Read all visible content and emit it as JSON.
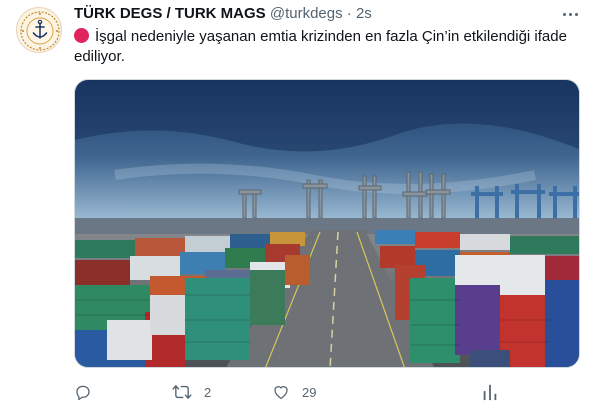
{
  "account": {
    "display_name": "TÜRK DEGS / TURK MAGS",
    "handle": "@turkdegs",
    "separator": "·",
    "time": "2s"
  },
  "tweet": {
    "text": "İşgal nedeniyle yaşanan emtia krizinden en fazla Çin’in etkilendiği ifade ediliyor.",
    "leading_emoji": "red-circle",
    "media_description": "container-port-photo"
  },
  "actions": {
    "reply_count": "",
    "retweet_count": "2",
    "like_count": "29"
  },
  "colors": {
    "text": "#0f1419",
    "secondary": "#536471",
    "emoji_red": "#e0245e",
    "sky_top": "#1c3b6a",
    "sky_bottom": "#8fb0cc"
  },
  "icons": [
    "more-icon",
    "reply-icon",
    "retweet-icon",
    "like-icon",
    "analytics-icon"
  ]
}
